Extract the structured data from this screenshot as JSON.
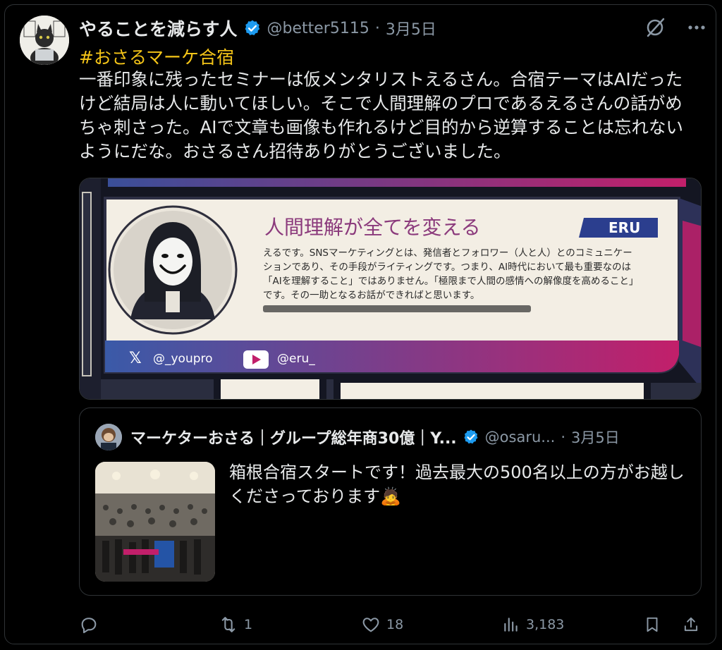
{
  "post": {
    "author_name": "やることを減らす人",
    "handle": "@better5115",
    "separator": "·",
    "date": "3月5日",
    "hashtag": "#おさるマーケ合宿",
    "text": "一番印象に残ったセミナーは仮メンタリストえるさん。合宿テーマはAIだったけど結局は人に動いてほしい。そこで人間理解のプロであるえるさんの話がめちゃ刺さった。AIで文章も画像も作れるけど目的から逆算することは忘れないようにだな。おさるさん招待ありがとうございました。"
  },
  "photo": {
    "headline": "人間理解が全てを変える",
    "badge": "ERU",
    "paragraph": "えるです。SNSマーケティングとは、発信者とフォロワー（人と人）とのコミュニケーションであり、その手段がライティングです。つまり、AI時代において最も重要なのは「AIを理解すること」ではありません。「極限まで人間の感情への解像度を高めること」です。その一助となるお話ができればと思います。",
    "x_handle": "@_youpro",
    "yt_handle": "@eru_"
  },
  "quote": {
    "author_name": "マーケターおさる｜グループ総年商30億｜Y...",
    "handle": "@osaru...",
    "separator": "·",
    "date": "3月5日",
    "text": "箱根合宿スタートです！過去最大の500名以上の方がお越しくださっております🙇"
  },
  "actions": {
    "reply_count": "",
    "retweet_count": "1",
    "like_count": "18",
    "view_count": "3,183"
  },
  "colors": {
    "accent_blue": "#1d9bf0",
    "hashtag_yellow": "#f5c518",
    "muted": "#8b98a5"
  },
  "icons": [
    "grok-icon",
    "more-icon",
    "verified-icon",
    "reply-icon",
    "retweet-icon",
    "like-icon",
    "views-icon",
    "bookmark-icon",
    "share-icon"
  ]
}
